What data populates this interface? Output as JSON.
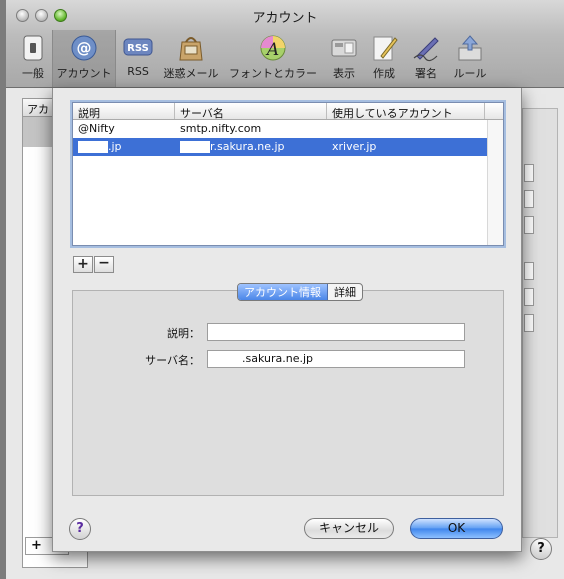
{
  "window": {
    "title": "アカウント"
  },
  "toolbar": {
    "items": [
      {
        "label": "一般",
        "icon": "general-switch-icon"
      },
      {
        "label": "アカウント",
        "icon": "at-sign-icon"
      },
      {
        "label": "RSS",
        "icon": "rss-badge-icon"
      },
      {
        "label": "迷惑メール",
        "icon": "junk-mail-bag-icon"
      },
      {
        "label": "フォントとカラー",
        "icon": "font-color-icon"
      },
      {
        "label": "表示",
        "icon": "view-display-icon"
      },
      {
        "label": "作成",
        "icon": "compose-pencil-icon"
      },
      {
        "label": "署名",
        "icon": "signature-pen-icon"
      },
      {
        "label": "ルール",
        "icon": "rules-arrows-icon"
      }
    ],
    "selected_index": 1
  },
  "accounts_table": {
    "columns": [
      "説明",
      "サーバ名",
      "使用しているアカウント"
    ],
    "rows": [
      {
        "description": "@Nifty",
        "server": "smtp.nifty.com",
        "account": ""
      },
      {
        "description": ".jp",
        "server": "r.sakura.ne.jp",
        "account": "xriver.jp"
      }
    ],
    "selected_row": 1
  },
  "buttons": {
    "add": "+",
    "remove": "−",
    "help": "?",
    "cancel": "キャンセル",
    "ok": "OK"
  },
  "detail": {
    "tabs": [
      "アカウント情報",
      "詳細"
    ],
    "active_tab": 0,
    "fields": {
      "description_label": "説明：",
      "description_value": "",
      "server_label": "サーバ名：",
      "server_value": ".sakura.ne.jp"
    }
  },
  "background_window": {
    "list_header": "アカ",
    "add_label": "+",
    "help_label": "?"
  },
  "colors": {
    "selection": "#3d70d6",
    "ok_button": "#5f9ef3"
  }
}
